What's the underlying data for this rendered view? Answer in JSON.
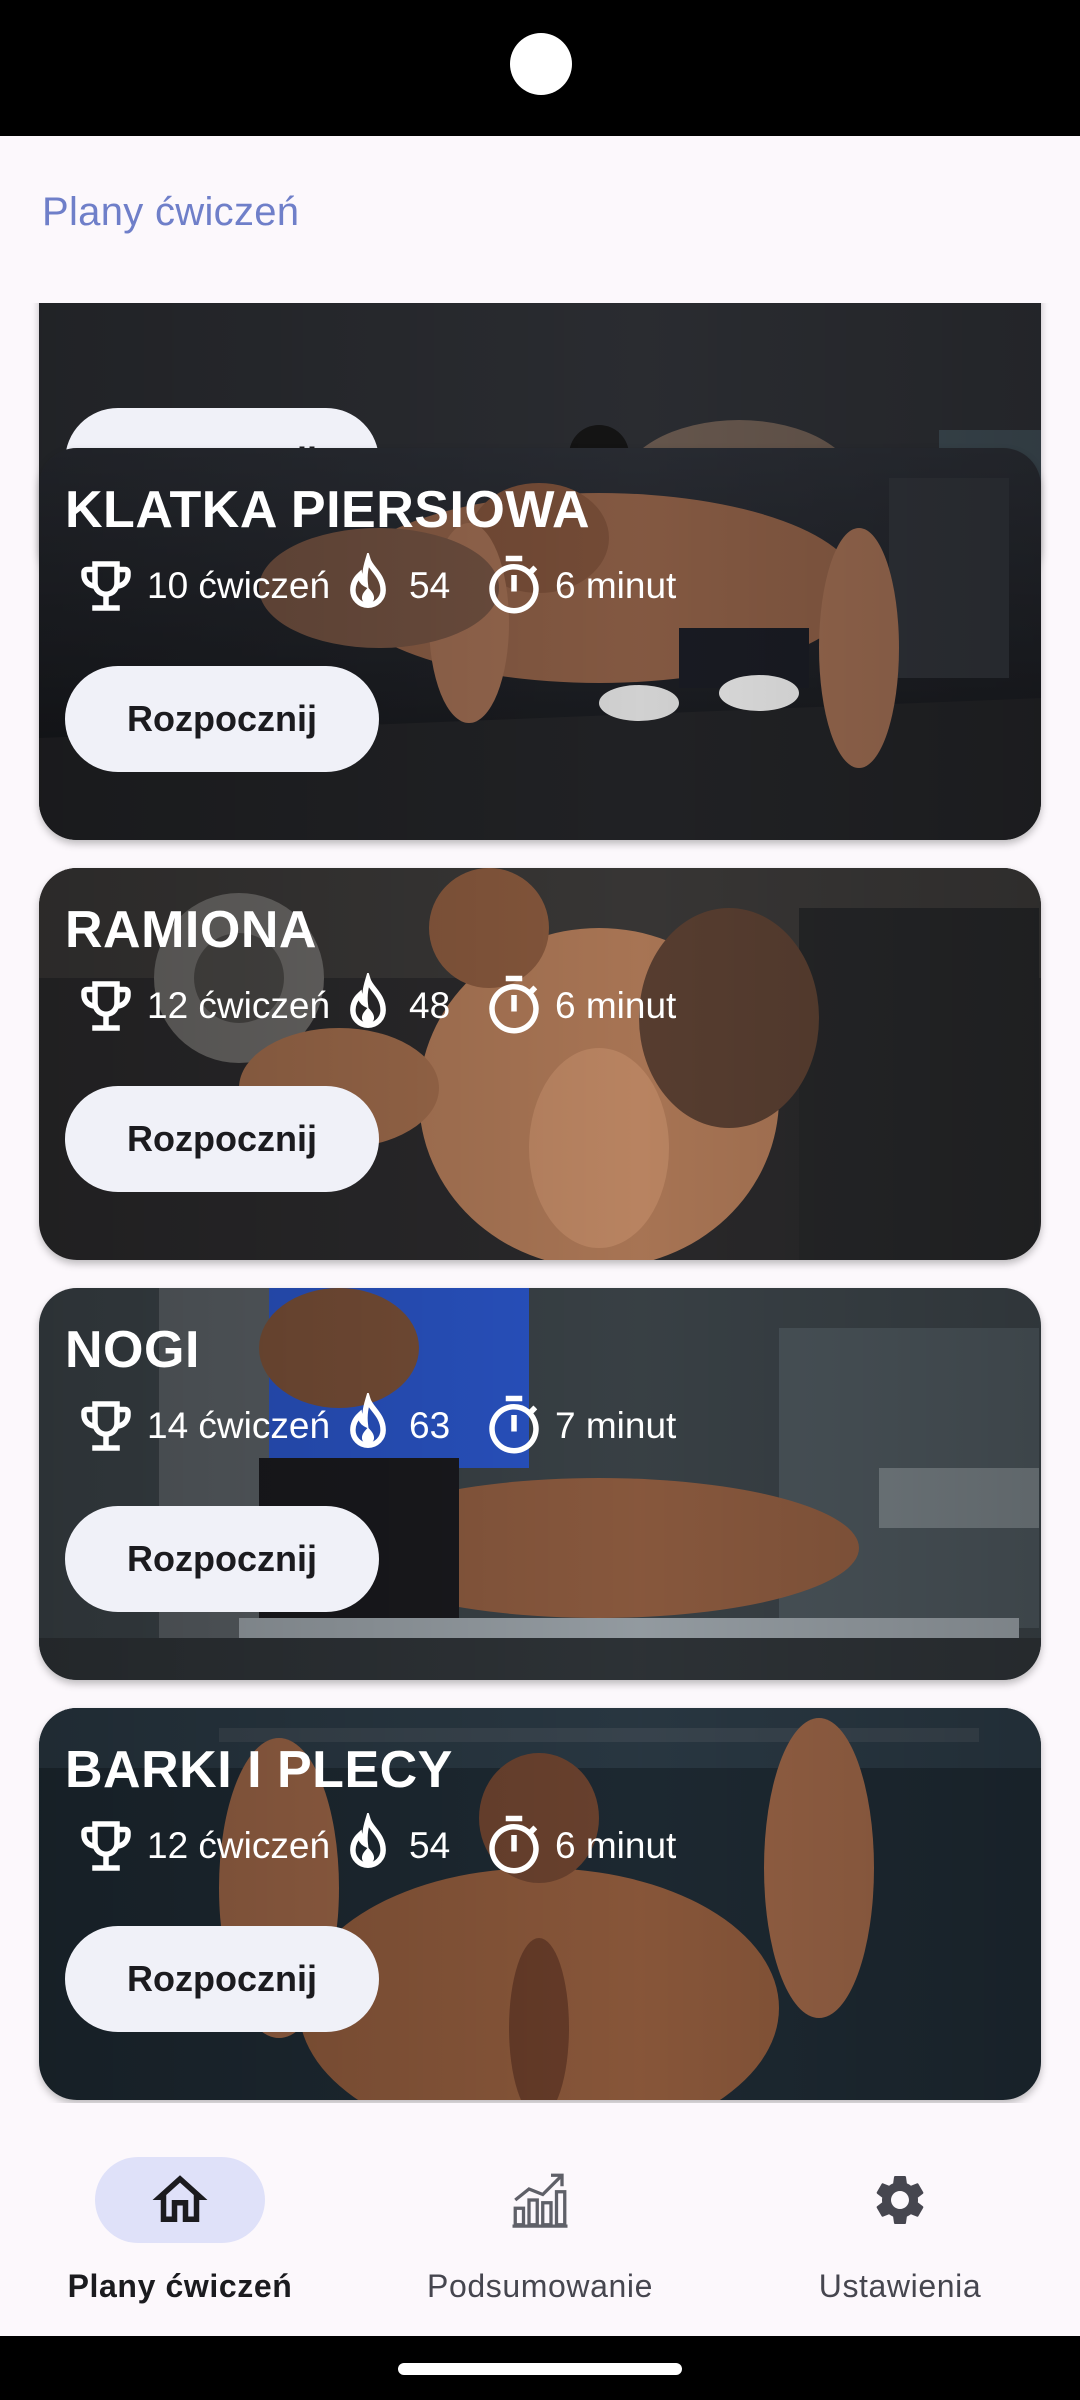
{
  "app": {
    "title": "Plany ćwiczeń"
  },
  "partial_card": {
    "button_label": "Rozpocznij"
  },
  "cards": [
    {
      "title": "KLATKA PIERSIOWA",
      "exercises": "10 ćwiczeń",
      "calories": "54",
      "duration": "6 minut",
      "button_label": "Rozpocznij"
    },
    {
      "title": "RAMIONA",
      "exercises": "12 ćwiczeń",
      "calories": "48",
      "duration": "6 minut",
      "button_label": "Rozpocznij"
    },
    {
      "title": "NOGI",
      "exercises": "14 ćwiczeń",
      "calories": "63",
      "duration": "7 minut",
      "button_label": "Rozpocznij"
    },
    {
      "title": "BARKI I PLECY",
      "exercises": "12 ćwiczeń",
      "calories": "54",
      "duration": "6 minut",
      "button_label": "Rozpocznij"
    }
  ],
  "bottom_nav": {
    "items": [
      {
        "label": "Plany ćwiczeń",
        "icon": "home-icon",
        "active": true
      },
      {
        "label": "Podsumowanie",
        "icon": "chart-growth-icon",
        "active": false
      },
      {
        "label": "Ustawienia",
        "icon": "gear-icon",
        "active": false
      }
    ]
  },
  "colors": {
    "accent": "#6f7fc9",
    "background": "#fcf8fc",
    "nav_active_pill": "#dfe1f9",
    "button_bg": "#f0f1f8"
  }
}
